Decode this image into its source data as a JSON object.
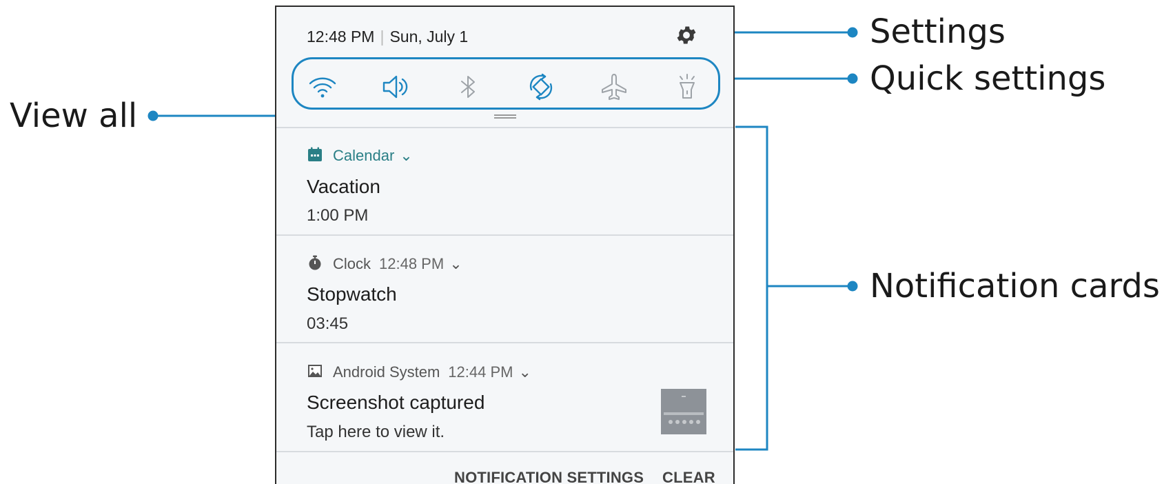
{
  "status": {
    "time": "12:48 PM",
    "date": "Sun, July 1"
  },
  "quick_settings": [
    {
      "icon": "wifi-icon"
    },
    {
      "icon": "sound-icon"
    },
    {
      "icon": "bluetooth-icon"
    },
    {
      "icon": "auto-rotate-icon"
    },
    {
      "icon": "airplane-mode-icon"
    },
    {
      "icon": "flashlight-icon"
    }
  ],
  "notifications": [
    {
      "app": "Calendar",
      "time": "",
      "title": "Vacation",
      "text": "1:00 PM",
      "icon": "calendar-icon"
    },
    {
      "app": "Clock",
      "time": "12:48 PM",
      "title": "Stopwatch",
      "text": "03:45",
      "icon": "stopwatch-icon"
    },
    {
      "app": "Android System",
      "time": "12:44 PM",
      "title": "Screenshot captured",
      "text": "Tap here to view it.",
      "icon": "image-icon"
    }
  ],
  "footer": {
    "settings_label": "NOTIFICATION SETTINGS",
    "clear_label": "CLEAR"
  },
  "callouts": {
    "settings": "Settings",
    "quick_settings": "Quick settings",
    "view_all": "View all",
    "notification_cards": "Notification cards"
  },
  "colors": {
    "callout_line": "#1d86c2",
    "icon_blue": "#1d86c2",
    "icon_grey": "#9ea3a8",
    "calendar_teal": "#2a7f86"
  }
}
